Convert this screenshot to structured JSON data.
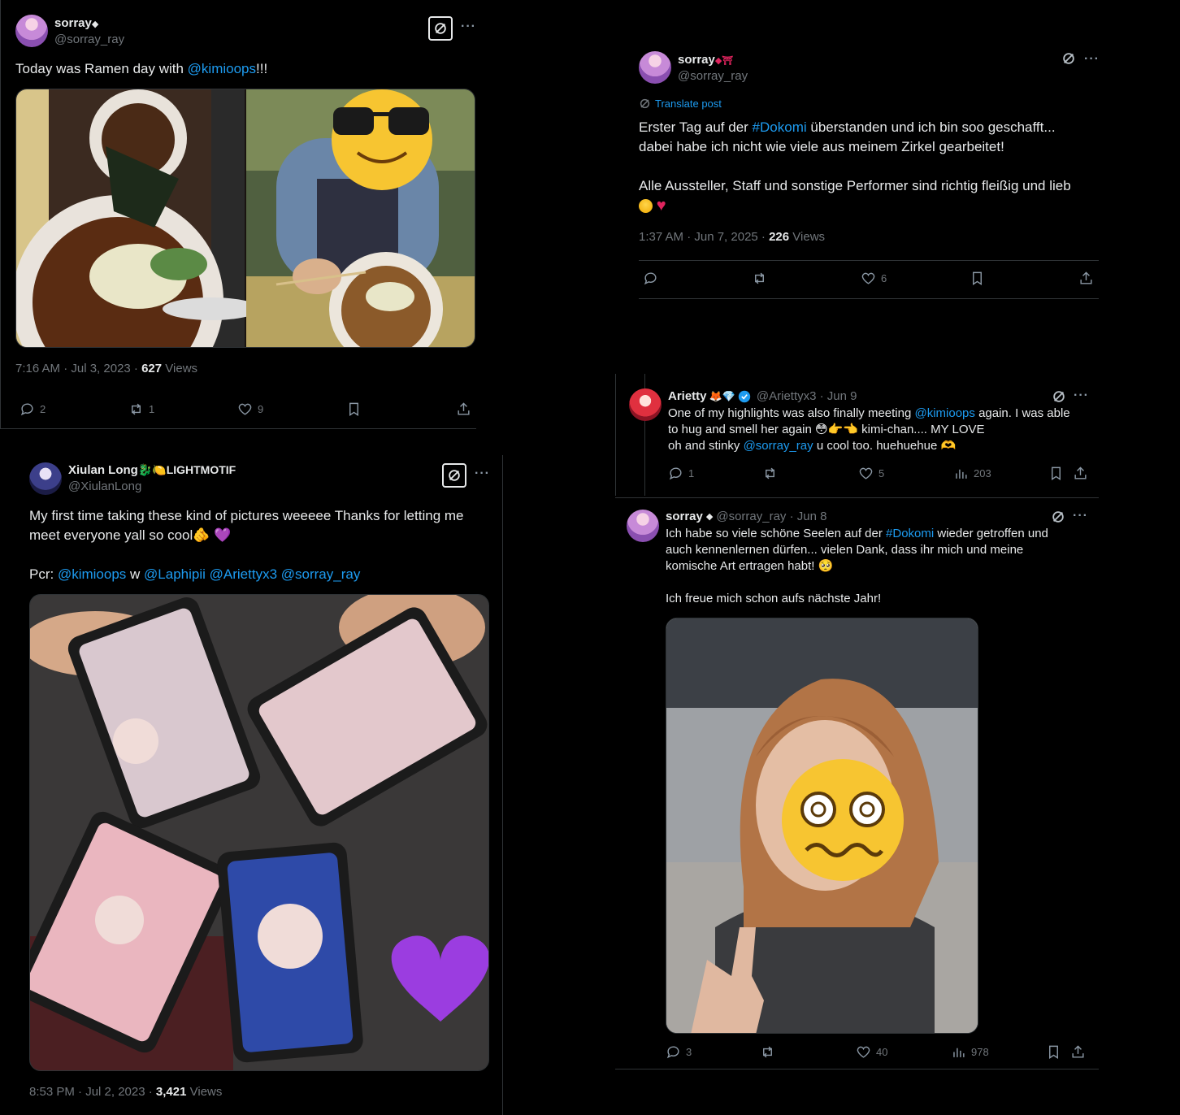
{
  "tweet1": {
    "name": "sorray",
    "name_badge": "◆",
    "handle": "@sorray_ray",
    "text_before": "Today was Ramen day with ",
    "mention": "@kimioops",
    "text_after": "!!!",
    "time": "7:16 AM · Jul 3, 2023 · ",
    "views_count": "627",
    "views_label": " Views",
    "replies": "2",
    "retweets": "1",
    "likes": "9"
  },
  "tweet2": {
    "name": "sorray",
    "name_badge": "◆⛩",
    "handle": "@sorray_ray",
    "translate": "Translate post",
    "line1_a": "Erster Tag auf der ",
    "hashtag": "#Dokomi",
    "line1_b": " überstanden und ich bin soo geschafft...",
    "line2": "dabei habe ich nicht wie viele aus meinem Zirkel gearbeitet!",
    "line3": "Alle Aussteller, Staff und sonstige Performer sind richtig fleißig und lieb",
    "time": "1:37 AM · Jun 7, 2025 · ",
    "views_count": "226",
    "views_label": " Views",
    "likes": "6"
  },
  "tweet3": {
    "name": "Arietty",
    "name_badge": "🦊💎",
    "handle": "@Ariettyx3 · Jun 9",
    "l1_a": "One of my highlights was also finally meeting ",
    "l1_mention": "@kimioops",
    "l1_b": " again. I was able",
    "l2": "to hug and smell her again 😳👉👈 kimi-chan.... MY LOVE",
    "l3_a": "oh and stinky ",
    "l3_mention": "@sorray_ray",
    "l3_b": " u cool too. huehuehue 🫶",
    "replies": "1",
    "likes": "5",
    "views": "203"
  },
  "tweet4": {
    "name": "Xiulan Long",
    "name_badge": "🐉🍋LIGHTMOTIF",
    "handle": "@XiulanLong",
    "l1": "My first time taking these kind of pictures weeeee Thanks for letting me",
    "l2": "meet everyone yall so cool🫵 💜",
    "pcr": "Pcr: ",
    "m1": "@kimioops",
    "w": " w ",
    "m2": "@Laphipii",
    "m3": " @Ariettyx3",
    "m4": " @sorray_ray",
    "time": "8:53 PM · Jul 2, 2023 · ",
    "views_count": "3,421",
    "views_label": " Views"
  },
  "tweet5": {
    "name": "sorray",
    "name_badge": "◆",
    "handle": "@sorray_ray · Jun 8",
    "l1_a": "Ich habe so viele schöne Seelen auf der ",
    "hashtag": "#Dokomi",
    "l1_b": " wieder getroffen und",
    "l2": "auch kennenlernen dürfen... vielen Dank, dass ihr mich und meine",
    "l3": "komische Art ertragen habt! 🥺",
    "l4": "Ich freue mich schon aufs nächste Jahr!",
    "replies": "3",
    "likes": "40",
    "views": "978"
  },
  "colors": {
    "background": "#000000",
    "text": "#e7e9ea",
    "muted": "#71767b",
    "link": "#1d9bf0",
    "border": "#2f3336",
    "heart": "#f91880",
    "verified": "#1d9bf0"
  }
}
